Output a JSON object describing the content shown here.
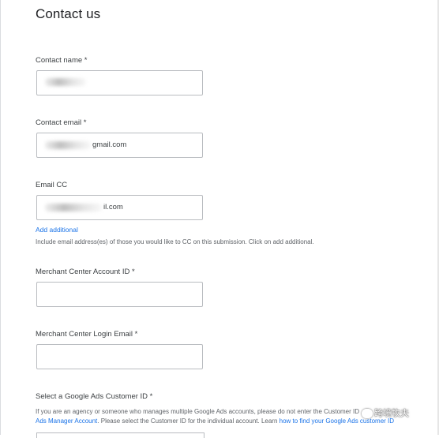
{
  "page": {
    "title": "Contact us"
  },
  "form": {
    "contact_name": {
      "label": "Contact name *",
      "value": ""
    },
    "contact_email": {
      "label": "Contact email *",
      "value_visible": "gmail.com"
    },
    "email_cc": {
      "label": "Email CC",
      "value_visible": "il.com",
      "add_link": "Add additional",
      "help": "Include email address(es) of those you would like to CC on this submission. Click on add additional."
    },
    "merchant_account_id": {
      "label": "Merchant Center Account ID *",
      "value": ""
    },
    "merchant_login_email": {
      "label": "Merchant Center Login Email *",
      "value": ""
    },
    "ads_customer_id": {
      "label": "Select a Google Ads Customer ID *",
      "help_line1": "If you are an agency or someone who manages multiple Google Ads accounts, please do not enter the Customer ID",
      "help_line2_link1": "Ads Manager Account",
      "help_line2_text": ". Please select the Customer ID for the individual account. Learn ",
      "help_line2_link2": "how to find your Google Ads customer ID"
    }
  },
  "watermark": {
    "text": "跨境牧夫"
  }
}
